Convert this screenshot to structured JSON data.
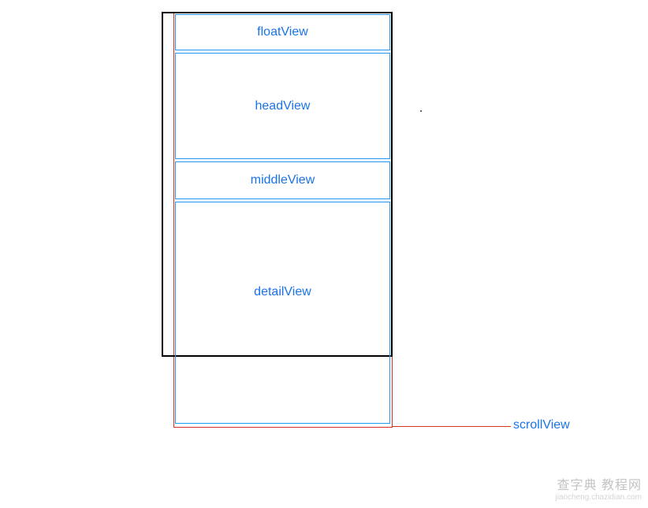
{
  "labels": {
    "floatView": "floatView",
    "headView": "headView",
    "middleView": "middleView",
    "detailView": "detailView",
    "scrollView": "scrollView"
  },
  "watermark": {
    "line1": "查字典 教程网",
    "line2": "jiaocheng.chazidian.com"
  }
}
